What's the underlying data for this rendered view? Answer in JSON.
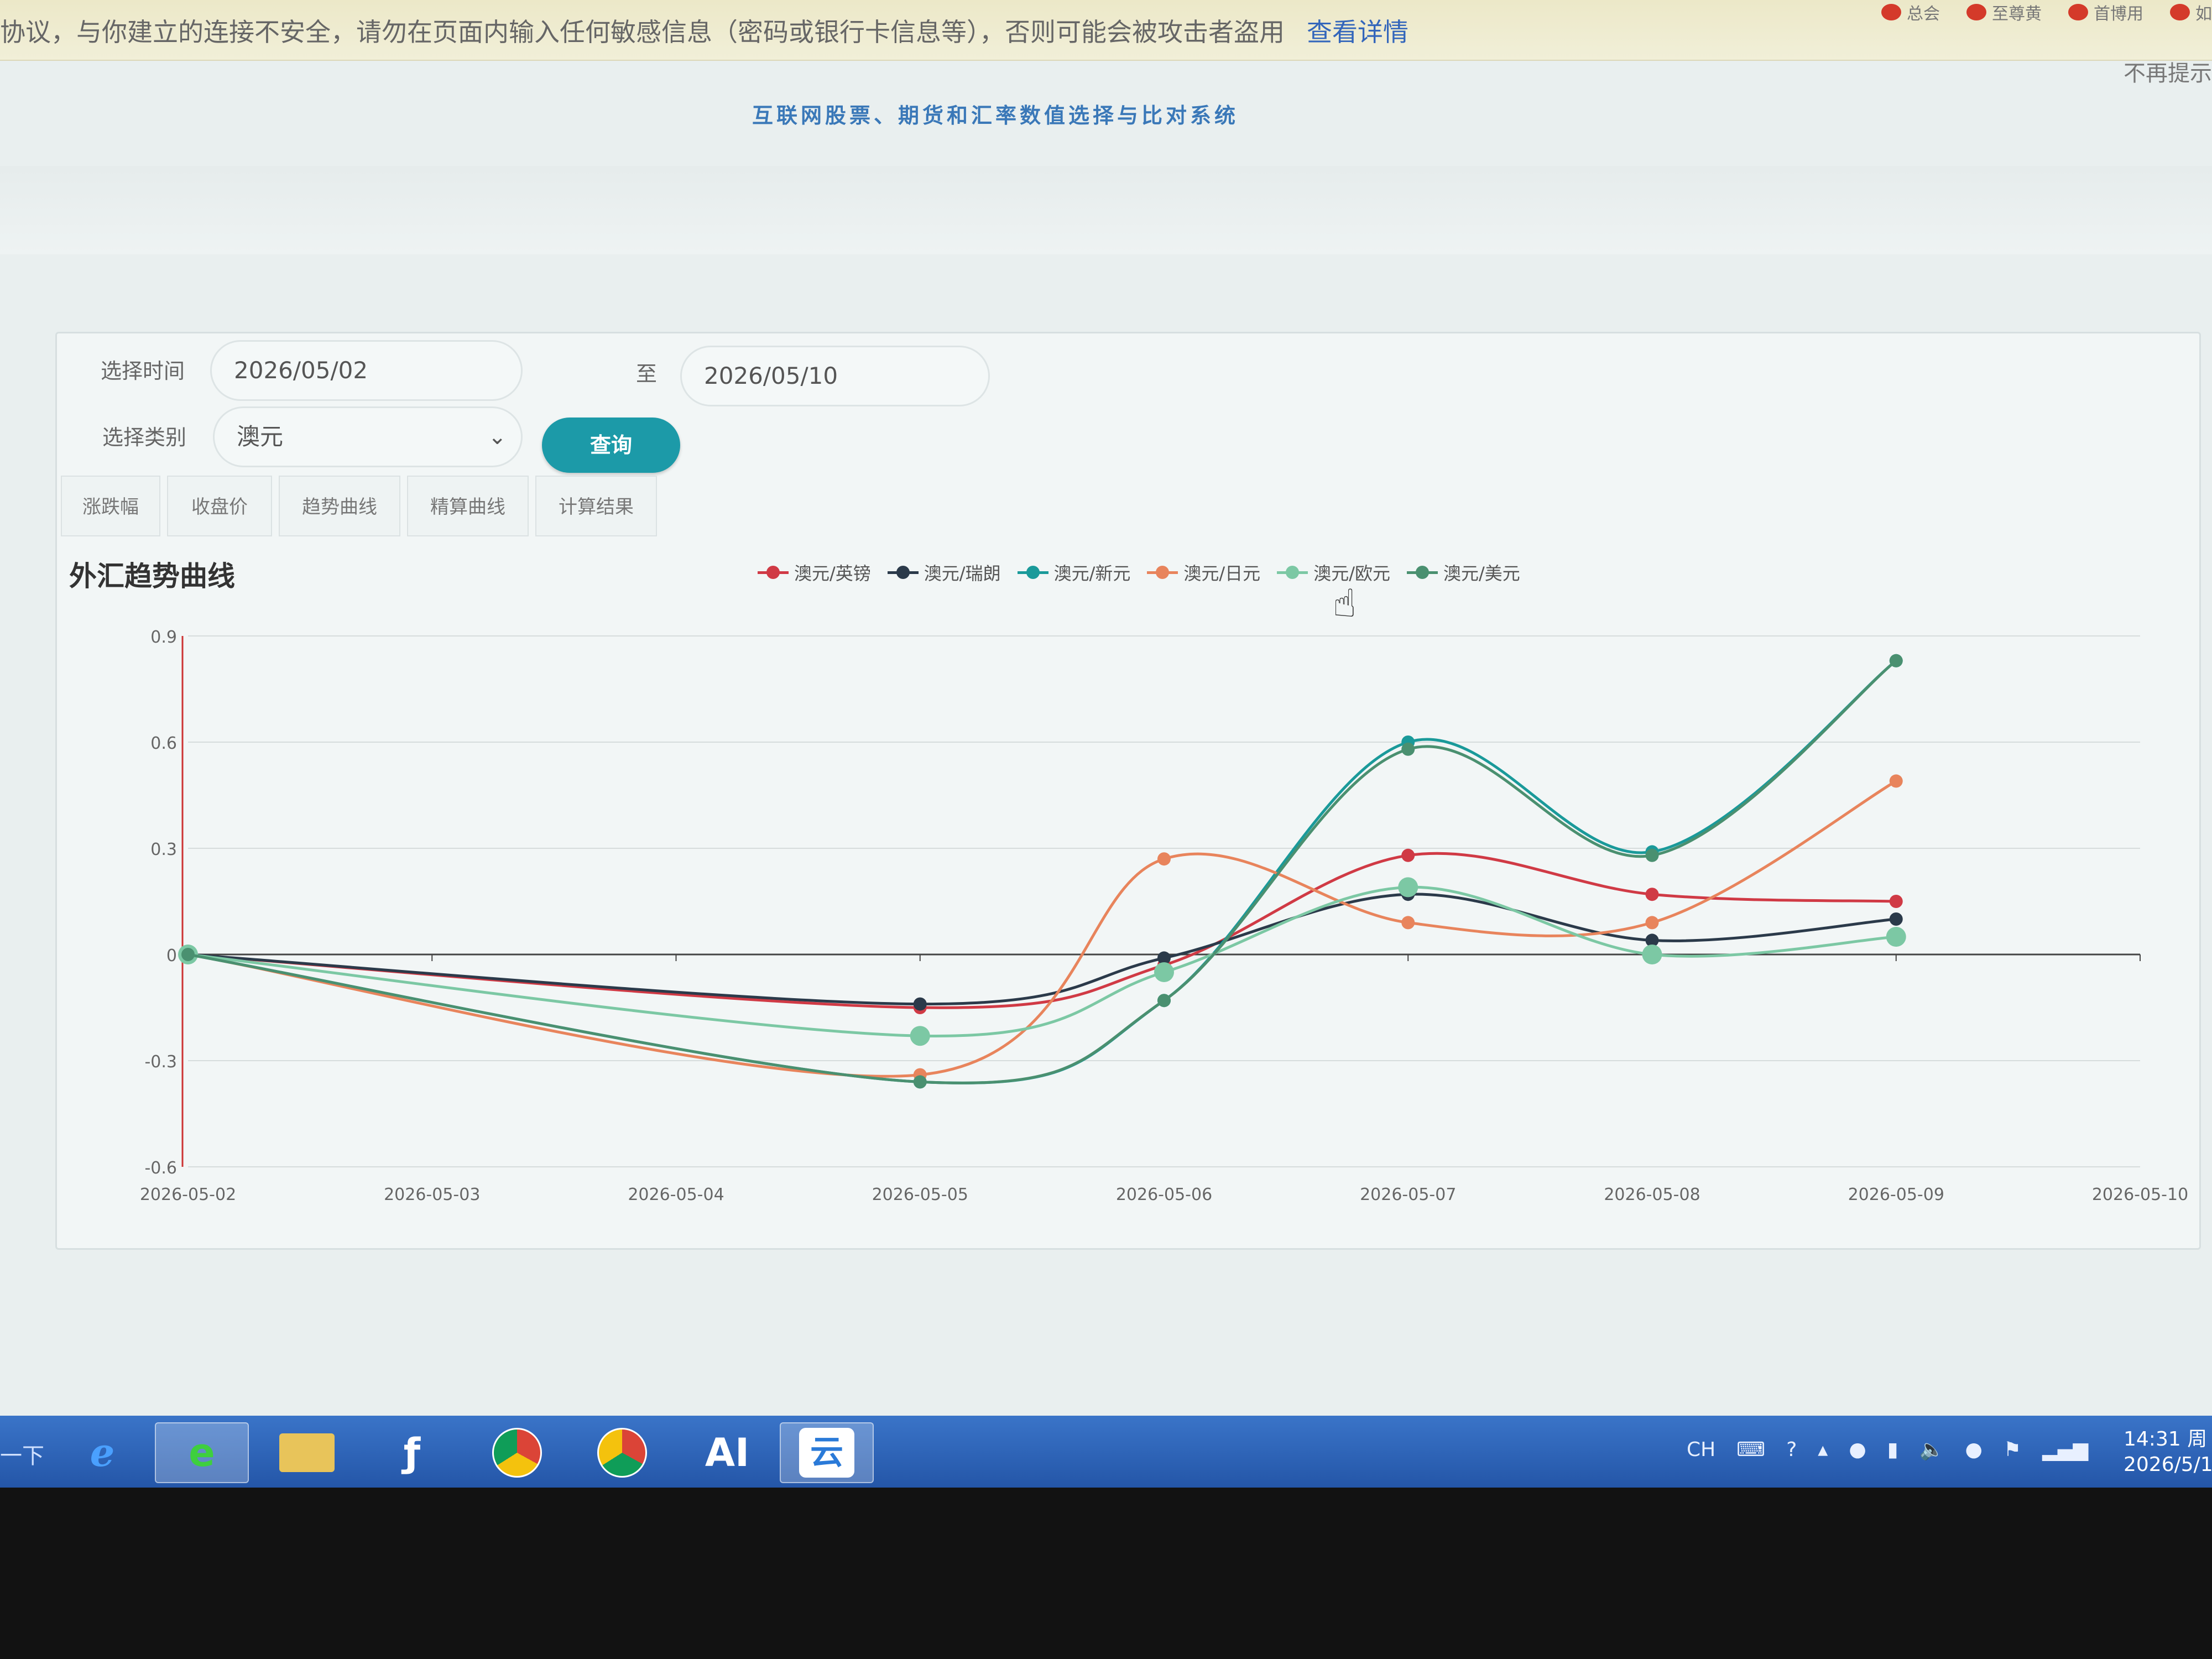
{
  "warning": {
    "text": "协议，与你建立的连接不安全，请勿在页面内输入任何敏感信息（密码或银行卡信息等），否则可能会被攻击者盗用",
    "link": "查看详情",
    "dismiss": "不再提示",
    "tabs": [
      "总会",
      "至尊黄",
      "首博用",
      "如"
    ]
  },
  "page": {
    "title": "互联网股票、期货和汇率数值选择与比对系统"
  },
  "form": {
    "time_label": "选择时间",
    "start_date": "2026/05/02",
    "to_label": "至",
    "end_date": "2026/05/10",
    "category_label": "选择类别",
    "category_value": "澳元",
    "query_button": "查询"
  },
  "tabs": [
    "涨跌幅",
    "收盘价",
    "趋势曲线",
    "精算曲线",
    "计算结果"
  ],
  "colors": {
    "accent": "#1c9aa8",
    "series": [
      "#d03a45",
      "#2b3a4a",
      "#1a9a9a",
      "#e8845c",
      "#7cc8a4",
      "#4a9070"
    ]
  },
  "chart_data": {
    "type": "line",
    "title": "外汇趋势曲线",
    "x": [
      "2026-05-02",
      "2026-05-03",
      "2026-05-04",
      "2026-05-05",
      "2026-05-06",
      "2026-05-07",
      "2026-05-08",
      "2026-05-09",
      "2026-05-10"
    ],
    "ylim": [
      -0.6,
      0.9
    ],
    "yticks": [
      "0.9",
      "0.6",
      "0.3",
      "0",
      "-0.3",
      "-0.6"
    ],
    "grid": true,
    "legend_position": "top-center",
    "series": [
      {
        "name": "澳元/英镑",
        "points": [
          [
            0,
            0
          ],
          [
            3,
            -0.15
          ],
          [
            4,
            -0.03
          ],
          [
            5,
            0.28
          ],
          [
            6,
            0.17
          ],
          [
            7,
            0.15
          ]
        ]
      },
      {
        "name": "澳元/瑞朗",
        "points": [
          [
            0,
            0
          ],
          [
            3,
            -0.14
          ],
          [
            4,
            -0.01
          ],
          [
            5,
            0.17
          ],
          [
            6,
            0.04
          ],
          [
            7,
            0.1
          ]
        ]
      },
      {
        "name": "澳元/新元",
        "points": [
          [
            0,
            0
          ],
          [
            3,
            -0.36
          ],
          [
            4,
            -0.13
          ],
          [
            5,
            0.6
          ],
          [
            6,
            0.29
          ],
          [
            7,
            0.83
          ]
        ]
      },
      {
        "name": "澳元/日元",
        "points": [
          [
            0,
            0
          ],
          [
            3,
            -0.34
          ],
          [
            4,
            0.27
          ],
          [
            5,
            0.09
          ],
          [
            6,
            0.09
          ],
          [
            7,
            0.49
          ]
        ]
      },
      {
        "name": "澳元/欧元",
        "points": [
          [
            0,
            0
          ],
          [
            3,
            -0.23
          ],
          [
            4,
            -0.05
          ],
          [
            5,
            0.19
          ],
          [
            6,
            0
          ],
          [
            7,
            0.05
          ]
        ]
      },
      {
        "name": "澳元/美元",
        "points": [
          [
            0,
            0
          ],
          [
            3,
            -0.36
          ],
          [
            4,
            -0.13
          ],
          [
            5,
            0.58
          ],
          [
            6,
            0.28
          ],
          [
            7,
            0.83
          ]
        ]
      }
    ]
  },
  "taskbar": {
    "start_label": "一下",
    "icons": [
      "ie-icon",
      "browser-e-icon",
      "folder-icon",
      "flash-icon",
      "chrome-icon",
      "chrome-alt-icon",
      "ai-icon",
      "cloud-icon"
    ],
    "ai_label": "AI",
    "cloud_label": "云",
    "tray_lang": "CH",
    "time": "14:31 周",
    "date": "2026/5/1"
  }
}
